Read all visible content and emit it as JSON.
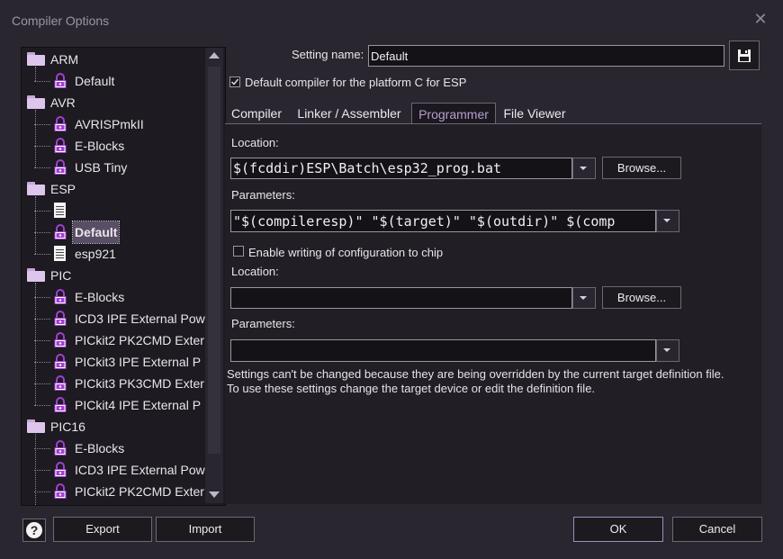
{
  "window": {
    "title": "Compiler Options",
    "close_icon": "close-icon"
  },
  "tree": {
    "items": [
      {
        "label": "ARM",
        "icon": "folder-icon",
        "level": 0
      },
      {
        "label": "Default",
        "icon": "lock-icon",
        "level": 1
      },
      {
        "label": "AVR",
        "icon": "folder-icon",
        "level": 0
      },
      {
        "label": "AVRISPmkII",
        "icon": "lock-icon",
        "level": 1
      },
      {
        "label": "E-Blocks",
        "icon": "lock-icon",
        "level": 1
      },
      {
        "label": "USB Tiny",
        "icon": "lock-icon",
        "level": 1
      },
      {
        "label": "ESP",
        "icon": "folder-icon",
        "level": 0
      },
      {
        "label": "",
        "icon": "document-icon",
        "level": 1
      },
      {
        "label": "Default",
        "icon": "lock-icon",
        "level": 1,
        "selected": true
      },
      {
        "label": "esp921",
        "icon": "document-icon",
        "level": 1
      },
      {
        "label": "PIC",
        "icon": "folder-icon",
        "level": 0
      },
      {
        "label": "E-Blocks",
        "icon": "lock-icon",
        "level": 1
      },
      {
        "label": "ICD3 IPE External Pow",
        "icon": "lock-icon",
        "level": 1
      },
      {
        "label": "PICkit2 PK2CMD Exter",
        "icon": "lock-icon",
        "level": 1
      },
      {
        "label": "PICkit3 IPE External P",
        "icon": "lock-icon",
        "level": 1
      },
      {
        "label": "PICkit3 PK3CMD Exter",
        "icon": "lock-icon",
        "level": 1
      },
      {
        "label": "PICkit4 IPE External P",
        "icon": "lock-icon",
        "level": 1
      },
      {
        "label": "PIC16",
        "icon": "folder-icon",
        "level": 0
      },
      {
        "label": "E-Blocks",
        "icon": "lock-icon",
        "level": 1
      },
      {
        "label": "ICD3 IPE External Pow",
        "icon": "lock-icon",
        "level": 1
      },
      {
        "label": "PICkit2 PK2CMD Exter",
        "icon": "lock-icon",
        "level": 1
      }
    ]
  },
  "setting": {
    "name_label": "Setting name:",
    "name_value": "Default",
    "save_icon": "save-icon"
  },
  "default_checkbox": {
    "label": "Default compiler for the platform C for ESP",
    "checked": true
  },
  "tabs": [
    {
      "label": "Compiler",
      "active": false
    },
    {
      "label": "Linker / Assembler",
      "active": false
    },
    {
      "label": "Programmer",
      "active": true
    },
    {
      "label": "File Viewer",
      "active": false
    }
  ],
  "programmer": {
    "location_label": "Location:",
    "location_value": "$(fcddir)ESP\\Batch\\esp32_prog.bat",
    "browse_label": "Browse...",
    "parameters_label": "Parameters:",
    "parameters_value": "\"$(compileresp)\" \"$(target)\" \"$(outdir)\" $(comp",
    "config": {
      "checkbox_label": "Enable writing of configuration to chip",
      "checked": false,
      "location_label": "Location:",
      "location_value": "",
      "browse_label": "Browse...",
      "parameters_label": "Parameters:",
      "parameters_value": ""
    },
    "note": "Settings can't be changed because they are being overridden by the current target definition file. To use these settings change the target device or edit the definition file."
  },
  "footer": {
    "help_icon": "help-icon",
    "help_glyph": "?",
    "export_label": "Export",
    "import_label": "Import",
    "ok_label": "OK",
    "cancel_label": "Cancel"
  },
  "colors": {
    "accent": "#b69fd0",
    "folder": "#ddc5ec",
    "lock": "#a040d0",
    "background": "#2a2630"
  }
}
